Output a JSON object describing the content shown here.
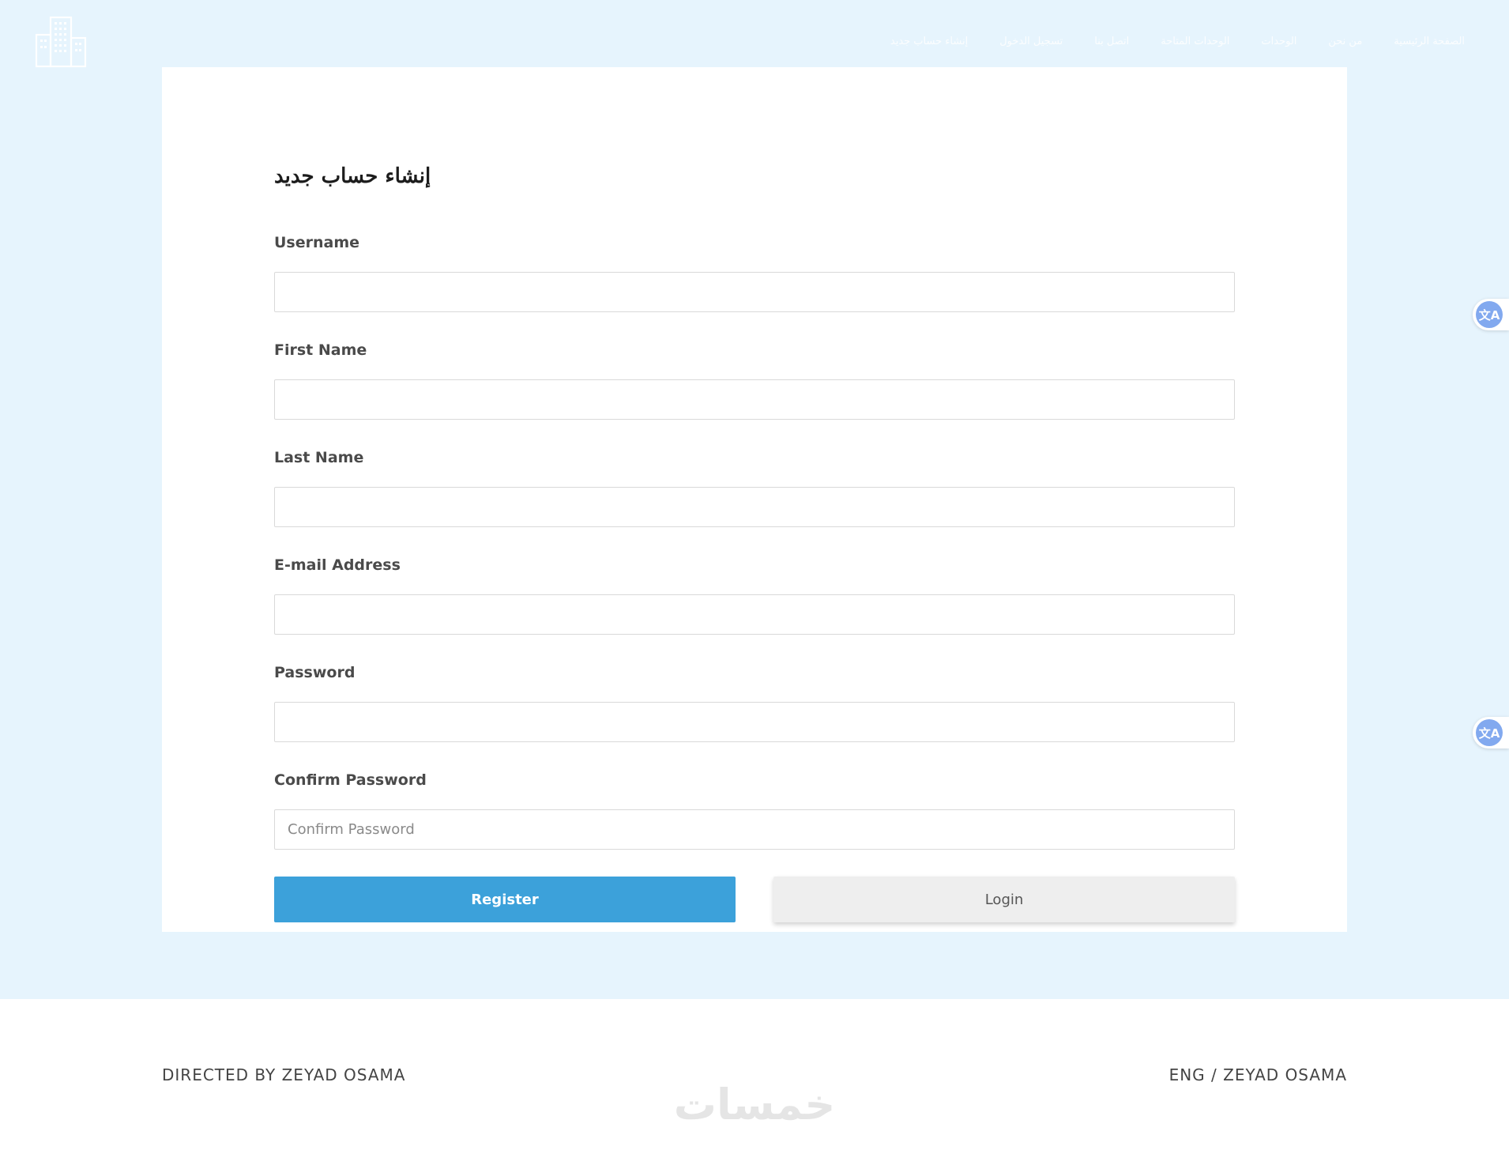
{
  "header": {
    "logo_icon": "building-icon",
    "nav_items": [
      "الصفحة الرئيسية",
      "من نحن",
      "الوحدات",
      "الوحدات المتاحة",
      "اتصل بنا",
      "تسجيل الدخول",
      "إنشاء حساب جديد"
    ]
  },
  "form": {
    "title": "إنشاء حساب جديد",
    "fields": [
      {
        "label": "Username",
        "value": "",
        "placeholder": ""
      },
      {
        "label": "First Name",
        "value": "",
        "placeholder": ""
      },
      {
        "label": "Last Name",
        "value": "",
        "placeholder": ""
      },
      {
        "label": "E-mail Address",
        "value": "",
        "placeholder": ""
      },
      {
        "label": "Password",
        "value": "",
        "placeholder": ""
      },
      {
        "label": "Confirm Password",
        "value": "",
        "placeholder": "Confirm Password"
      }
    ],
    "register_label": "Register",
    "login_label": "Login"
  },
  "translate_widget": {
    "icon": "translate-icon",
    "glyph": "文A"
  },
  "footer": {
    "left_text": "DIRECTED BY ZEYAD OSAMA",
    "right_text": "ENG / ZEYAD OSAMA",
    "watermark": "خمسات"
  },
  "colors": {
    "page_background": "#e6f4fd",
    "primary_button": "#3ca1da",
    "secondary_button": "#eeeeee",
    "translate_badge": "#82a9ef"
  }
}
